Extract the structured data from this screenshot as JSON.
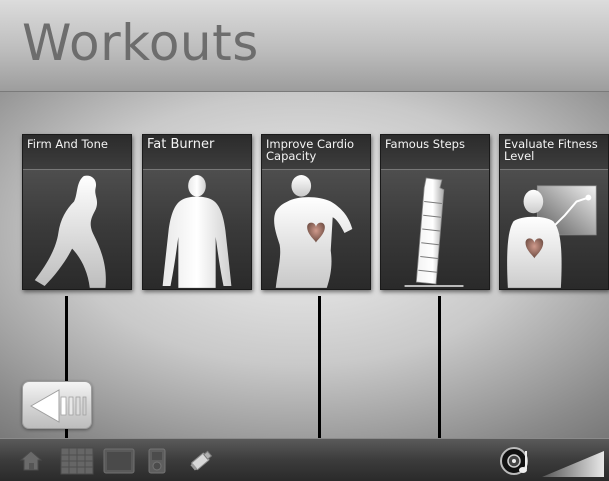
{
  "header": {
    "title": "Workouts"
  },
  "workouts": [
    {
      "label": "Firm And Tone",
      "icon": "female-silhouette-icon"
    },
    {
      "label": "Fat Burner",
      "icon": "standing-person-icon"
    },
    {
      "label": "Improve Cardio Capacity",
      "icon": "running-person-heart-icon"
    },
    {
      "label": "Famous Steps",
      "icon": "leaning-tower-icon"
    },
    {
      "label": "Evaluate Fitness Level",
      "icon": "person-heart-chart-icon"
    }
  ],
  "navigation": {
    "back_icon": "back-arrow-icon"
  },
  "taskbar": {
    "icons": [
      "home-icon",
      "calendar-grid-icon",
      "display-screen-icon",
      "media-player-icon",
      "usb-drive-icon",
      "music-note-icon",
      "volume-level-icon"
    ]
  },
  "colors": {
    "tile_bg": "#3a3a3a",
    "title_text": "#6d6d6d",
    "bar_bg": "#3c3c3c"
  }
}
